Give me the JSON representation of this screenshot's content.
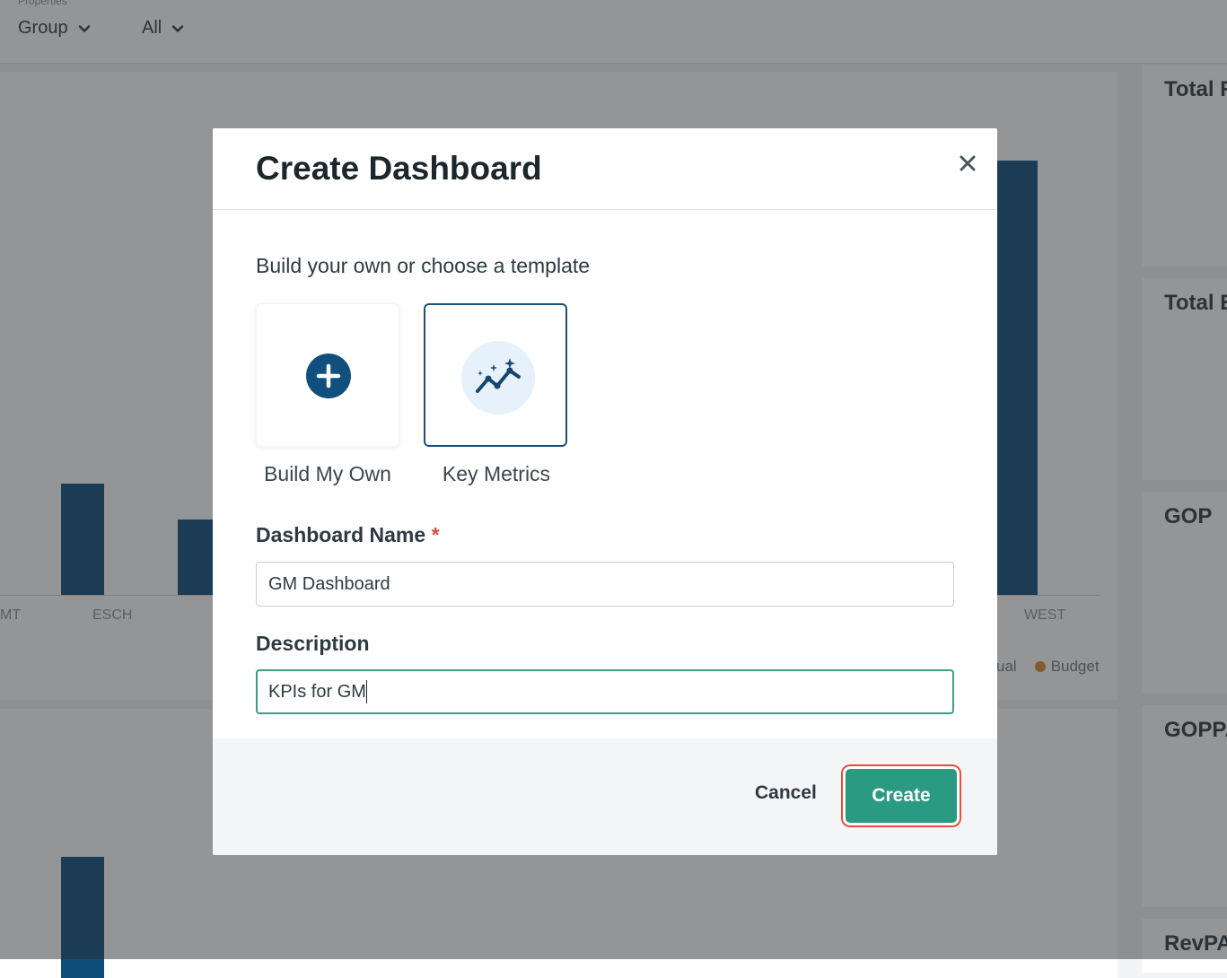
{
  "background": {
    "properties_label": "Properties",
    "filters": [
      {
        "label": "Group"
      },
      {
        "label": "All"
      }
    ],
    "chart": {
      "x_ticks": [
        "MT",
        "ESCH",
        "WEST"
      ],
      "legend": {
        "actual": "ual",
        "budget": "Budget"
      },
      "budget_color": "#e08a2e",
      "bar_color": "#0e4c7a"
    },
    "side_cards": [
      "Total R",
      "Total E",
      "GOP",
      "GOPPA",
      "RevPA"
    ]
  },
  "modal": {
    "title": "Create Dashboard",
    "close_icon": "close-icon",
    "subheading": "Build your own or choose a template",
    "templates": [
      {
        "label": "Build My Own",
        "icon": "plus-circle-icon",
        "selected": false
      },
      {
        "label": "Key Metrics",
        "icon": "sparkle-trend-icon",
        "selected": true
      }
    ],
    "name_field": {
      "label": "Dashboard Name",
      "required_mark": "*",
      "value": "GM Dashboard"
    },
    "description_field": {
      "label": "Description",
      "value": "KPIs for GM"
    },
    "cancel_label": "Cancel",
    "create_label": "Create",
    "accent_color": "#2b9a82"
  }
}
